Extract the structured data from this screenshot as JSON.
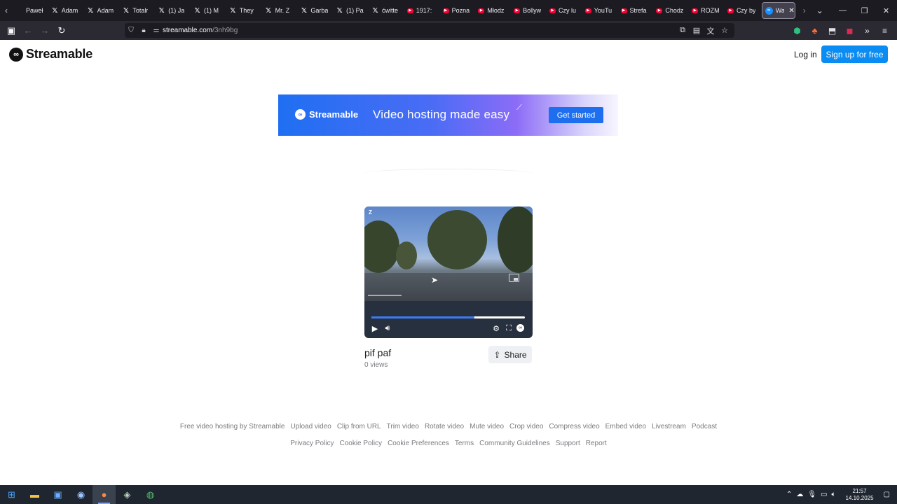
{
  "tabs": [
    {
      "label": "Paweł",
      "icon": "none"
    },
    {
      "label": "Adam",
      "icon": "x-icon"
    },
    {
      "label": "Adam",
      "icon": "x-icon"
    },
    {
      "label": "Totalr",
      "icon": "x-icon"
    },
    {
      "label": "(1) Ja",
      "icon": "x-icon"
    },
    {
      "label": "(1) M",
      "icon": "x-icon"
    },
    {
      "label": "They",
      "icon": "x-icon"
    },
    {
      "label": "Mr. Z",
      "icon": "x-icon"
    },
    {
      "label": "Garba",
      "icon": "x-icon"
    },
    {
      "label": "(1) Pa",
      "icon": "x-icon"
    },
    {
      "label": "ćwitte",
      "icon": "x-icon"
    },
    {
      "label": "1917:",
      "icon": "youtube-icon"
    },
    {
      "label": "Pozna",
      "icon": "youtube-icon"
    },
    {
      "label": "Młodz",
      "icon": "youtube-icon"
    },
    {
      "label": "Bollyw",
      "icon": "youtube-icon"
    },
    {
      "label": "Czy lu",
      "icon": "youtube-icon"
    },
    {
      "label": "YouTu",
      "icon": "youtube-icon"
    },
    {
      "label": "Strefa",
      "icon": "youtube-icon"
    },
    {
      "label": "Chodz",
      "icon": "youtube-icon"
    },
    {
      "label": "ROZM",
      "icon": "youtube-icon"
    },
    {
      "label": "Czy by",
      "icon": "youtube-icon"
    }
  ],
  "active_tab": {
    "label": "Wa",
    "icon": "streamable-icon"
  },
  "address": {
    "domain": "streamable.com",
    "path": "/3nh9bg"
  },
  "site": {
    "brand": "Streamable",
    "login_label": "Log in",
    "signup_label": "Sign up for free"
  },
  "banner": {
    "brand": "Streamable",
    "tagline": "Video hosting made easy",
    "cta_label": "Get started",
    "gradient_start": "#1f6ff2",
    "gradient_end": "#f7f6fe"
  },
  "player": {
    "camera_logo": "Z",
    "progress": 0.67,
    "accent_color": "#3a7bf6"
  },
  "video": {
    "title": "pif paf",
    "views": "0 views",
    "share_label": "Share"
  },
  "footer": {
    "row1": [
      "Free video hosting by Streamable",
      "Upload video",
      "Clip from URL",
      "Trim video",
      "Rotate video",
      "Mute video",
      "Crop video",
      "Compress video",
      "Embed video",
      "Livestream",
      "Podcast"
    ],
    "row2": [
      "Privacy Policy",
      "Cookie Policy",
      "Cookie Preferences",
      "Terms",
      "Community Guidelines",
      "Support",
      "Report"
    ]
  },
  "taskbar": {
    "time": "21:57",
    "date": "14.10.2025"
  }
}
